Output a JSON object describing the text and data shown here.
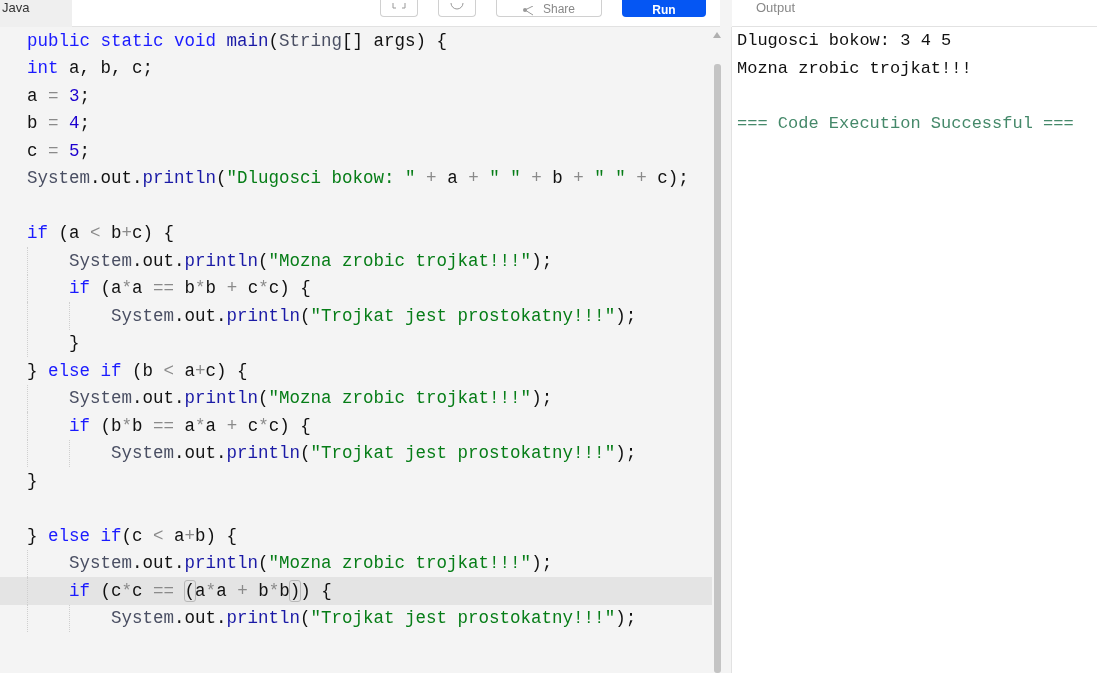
{
  "header": {
    "language_tab": "Java",
    "share": "Share",
    "run": "Run",
    "output_title": "Output"
  },
  "code": [
    {
      "highlighted": false,
      "tokens": [
        {
          "kind": "kw",
          "text": "public static void "
        },
        {
          "kind": "m",
          "text": "main"
        },
        {
          "kind": "p",
          "text": "("
        },
        {
          "kind": "t",
          "text": "String"
        },
        {
          "kind": "p",
          "text": "[] args) {"
        }
      ]
    },
    {
      "highlighted": false,
      "tokens": [
        {
          "kind": "kw",
          "text": "int"
        },
        {
          "kind": "p",
          "text": " a, b, c;"
        }
      ]
    },
    {
      "highlighted": false,
      "tokens": [
        {
          "kind": "p",
          "text": "a "
        },
        {
          "kind": "o",
          "text": "= "
        },
        {
          "kind": "n",
          "text": "3"
        },
        {
          "kind": "p",
          "text": ";"
        }
      ]
    },
    {
      "highlighted": false,
      "tokens": [
        {
          "kind": "p",
          "text": "b "
        },
        {
          "kind": "o",
          "text": "= "
        },
        {
          "kind": "n",
          "text": "4"
        },
        {
          "kind": "p",
          "text": ";"
        }
      ]
    },
    {
      "highlighted": false,
      "tokens": [
        {
          "kind": "p",
          "text": "c "
        },
        {
          "kind": "o",
          "text": "= "
        },
        {
          "kind": "n",
          "text": "5"
        },
        {
          "kind": "p",
          "text": ";"
        }
      ]
    },
    {
      "highlighted": false,
      "tokens": [
        {
          "kind": "t",
          "text": "System"
        },
        {
          "kind": "p",
          "text": ".out."
        },
        {
          "kind": "m",
          "text": "println"
        },
        {
          "kind": "p",
          "text": "("
        },
        {
          "kind": "s",
          "text": "\"Dlugosci bokow: \" "
        },
        {
          "kind": "o",
          "text": "+ "
        },
        {
          "kind": "p",
          "text": "a "
        },
        {
          "kind": "o",
          "text": "+ "
        },
        {
          "kind": "s",
          "text": "\" \" "
        },
        {
          "kind": "o",
          "text": "+ "
        },
        {
          "kind": "p",
          "text": "b "
        },
        {
          "kind": "o",
          "text": "+ "
        },
        {
          "kind": "s",
          "text": "\" \" "
        },
        {
          "kind": "o",
          "text": "+ "
        },
        {
          "kind": "p",
          "text": "c);"
        }
      ]
    },
    {
      "highlighted": false
    },
    {
      "highlighted": false,
      "tokens": [
        {
          "kind": "kw",
          "text": "if"
        },
        {
          "kind": "p",
          "text": " (a "
        },
        {
          "kind": "o",
          "text": "< "
        },
        {
          "kind": "p",
          "text": "b"
        },
        {
          "kind": "o",
          "text": "+"
        },
        {
          "kind": "p",
          "text": "c) {"
        }
      ]
    },
    {
      "highlighted": false,
      "tokens": [
        {
          "kind": "t",
          "text": "    System"
        },
        {
          "kind": "p",
          "text": ".out."
        },
        {
          "kind": "m",
          "text": "println"
        },
        {
          "kind": "p",
          "text": "("
        },
        {
          "kind": "s",
          "text": "\"Mozna zrobic trojkat!!!\""
        },
        {
          "kind": "p",
          "text": ");"
        }
      ]
    },
    {
      "highlighted": false,
      "tokens": [
        {
          "kind": "kw",
          "text": "    if"
        },
        {
          "kind": "p",
          "text": " (a"
        },
        {
          "kind": "o",
          "text": "*"
        },
        {
          "kind": "p",
          "text": "a "
        },
        {
          "kind": "o",
          "text": "== "
        },
        {
          "kind": "p",
          "text": "b"
        },
        {
          "kind": "o",
          "text": "*"
        },
        {
          "kind": "p",
          "text": "b "
        },
        {
          "kind": "o",
          "text": "+ "
        },
        {
          "kind": "p",
          "text": "c"
        },
        {
          "kind": "o",
          "text": "*"
        },
        {
          "kind": "p",
          "text": "c) {"
        }
      ]
    },
    {
      "highlighted": false,
      "tokens": [
        {
          "kind": "t",
          "text": "        System"
        },
        {
          "kind": "p",
          "text": ".out."
        },
        {
          "kind": "m",
          "text": "println"
        },
        {
          "kind": "p",
          "text": "("
        },
        {
          "kind": "s",
          "text": "\"Trojkat jest prostokatny!!!\""
        },
        {
          "kind": "p",
          "text": ");"
        }
      ]
    },
    {
      "highlighted": false,
      "tokens": [
        {
          "kind": "p",
          "text": "    }"
        }
      ]
    },
    {
      "highlighted": false,
      "tokens": [
        {
          "kind": "p",
          "text": "} "
        },
        {
          "kind": "kw",
          "text": "else if"
        },
        {
          "kind": "p",
          "text": " (b "
        },
        {
          "kind": "o",
          "text": "< "
        },
        {
          "kind": "p",
          "text": "a"
        },
        {
          "kind": "o",
          "text": "+"
        },
        {
          "kind": "p",
          "text": "c) {"
        }
      ]
    },
    {
      "highlighted": false,
      "tokens": [
        {
          "kind": "t",
          "text": "    System"
        },
        {
          "kind": "p",
          "text": ".out."
        },
        {
          "kind": "m",
          "text": "println"
        },
        {
          "kind": "p",
          "text": "("
        },
        {
          "kind": "s",
          "text": "\"Mozna zrobic trojkat!!!\""
        },
        {
          "kind": "p",
          "text": ");"
        }
      ]
    },
    {
      "highlighted": false,
      "tokens": [
        {
          "kind": "kw",
          "text": "    if"
        },
        {
          "kind": "p",
          "text": " (b"
        },
        {
          "kind": "o",
          "text": "*"
        },
        {
          "kind": "p",
          "text": "b "
        },
        {
          "kind": "o",
          "text": "== "
        },
        {
          "kind": "p",
          "text": "a"
        },
        {
          "kind": "o",
          "text": "*"
        },
        {
          "kind": "p",
          "text": "a "
        },
        {
          "kind": "o",
          "text": "+ "
        },
        {
          "kind": "p",
          "text": "c"
        },
        {
          "kind": "o",
          "text": "*"
        },
        {
          "kind": "p",
          "text": "c) {"
        }
      ]
    },
    {
      "highlighted": false,
      "tokens": [
        {
          "kind": "t",
          "text": "        System"
        },
        {
          "kind": "p",
          "text": ".out."
        },
        {
          "kind": "m",
          "text": "println"
        },
        {
          "kind": "p",
          "text": "("
        },
        {
          "kind": "s",
          "text": "\"Trojkat jest prostokatny!!!\""
        },
        {
          "kind": "p",
          "text": ");"
        }
      ]
    },
    {
      "highlighted": false,
      "tokens": [
        {
          "kind": "p",
          "text": "}"
        }
      ]
    },
    {
      "highlighted": false
    },
    {
      "highlighted": false,
      "tokens": [
        {
          "kind": "p",
          "text": "} "
        },
        {
          "kind": "kw",
          "text": "else if"
        },
        {
          "kind": "p",
          "text": "(c "
        },
        {
          "kind": "o",
          "text": "< "
        },
        {
          "kind": "p",
          "text": "a"
        },
        {
          "kind": "o",
          "text": "+"
        },
        {
          "kind": "p",
          "text": "b) {"
        }
      ]
    },
    {
      "highlighted": false,
      "tokens": [
        {
          "kind": "t",
          "text": "    System"
        },
        {
          "kind": "p",
          "text": ".out."
        },
        {
          "kind": "m",
          "text": "println"
        },
        {
          "kind": "p",
          "text": "("
        },
        {
          "kind": "s",
          "text": "\"Mozna zrobic trojkat!!!\""
        },
        {
          "kind": "p",
          "text": ");"
        }
      ]
    },
    {
      "highlighted": true,
      "tokens": [
        {
          "kind": "kw",
          "text": "    if"
        },
        {
          "kind": "p",
          "text": " (c"
        },
        {
          "kind": "o",
          "text": "*"
        },
        {
          "kind": "p",
          "text": "c "
        },
        {
          "kind": "o",
          "text": "== "
        },
        {
          "kind": "bm",
          "text": "("
        },
        {
          "kind": "p",
          "text": "a"
        },
        {
          "kind": "o",
          "text": "*"
        },
        {
          "kind": "p",
          "text": "a "
        },
        {
          "kind": "o",
          "text": "+ "
        },
        {
          "kind": "p",
          "text": "b"
        },
        {
          "kind": "o",
          "text": "*"
        },
        {
          "kind": "p",
          "text": "b"
        },
        {
          "kind": "bm",
          "text": ")"
        },
        {
          "kind": "p",
          "text": ") {"
        }
      ]
    },
    {
      "highlighted": false,
      "tokens": [
        {
          "kind": "t",
          "text": "        System"
        },
        {
          "kind": "p",
          "text": ".out."
        },
        {
          "kind": "m",
          "text": "println"
        },
        {
          "kind": "p",
          "text": "("
        },
        {
          "kind": "s",
          "text": "\"Trojkat jest prostokatny!!!\""
        },
        {
          "kind": "p",
          "text": ");"
        }
      ]
    }
  ],
  "output": [
    {
      "kind": "plain",
      "text": "Dlugosci bokow: 3 4 5"
    },
    {
      "kind": "plain",
      "text": "Mozna zrobic trojkat!!!"
    },
    {
      "kind": "blank"
    },
    {
      "kind": "success",
      "text": "=== Code Execution Successful ==="
    }
  ]
}
